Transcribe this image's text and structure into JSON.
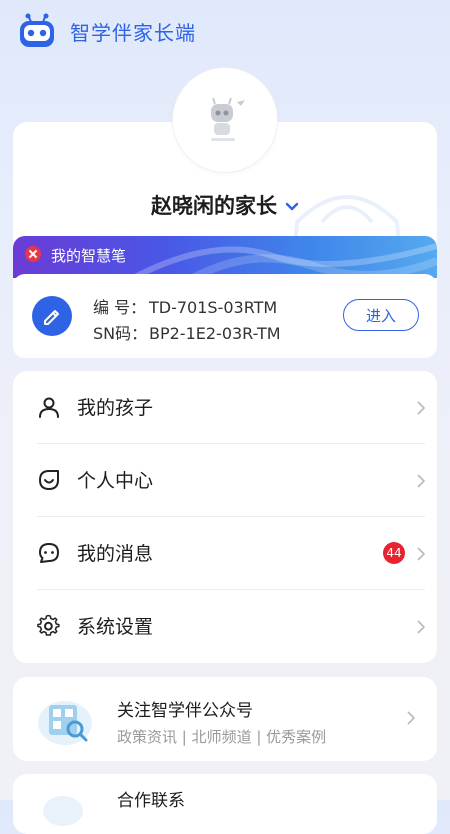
{
  "header": {
    "title": "智学伴家长端"
  },
  "profile": {
    "name": "赵晓闲的家长"
  },
  "pen": {
    "banner_label": "我的智慧笔",
    "id_key": "编 号：",
    "id_value": "TD-701S-03RTM",
    "sn_key": "SN码：",
    "sn_value": "BP2-1E2-03R-TM",
    "enter_label": "进入"
  },
  "menu": {
    "items": [
      {
        "label": "我的孩子",
        "icon": "person-icon"
      },
      {
        "label": "个人中心",
        "icon": "smile-icon"
      },
      {
        "label": "我的消息",
        "icon": "chat-icon",
        "badge": "44"
      },
      {
        "label": "系统设置",
        "icon": "gear-icon"
      }
    ]
  },
  "promo": {
    "title": "关注智学伴公众号",
    "subtitle": "政策资讯 | 北师频道 | 优秀案例"
  },
  "bottom": {
    "label": "合作联系"
  },
  "colors": {
    "accent": "#2e63e6",
    "badge": "#e8232f"
  }
}
